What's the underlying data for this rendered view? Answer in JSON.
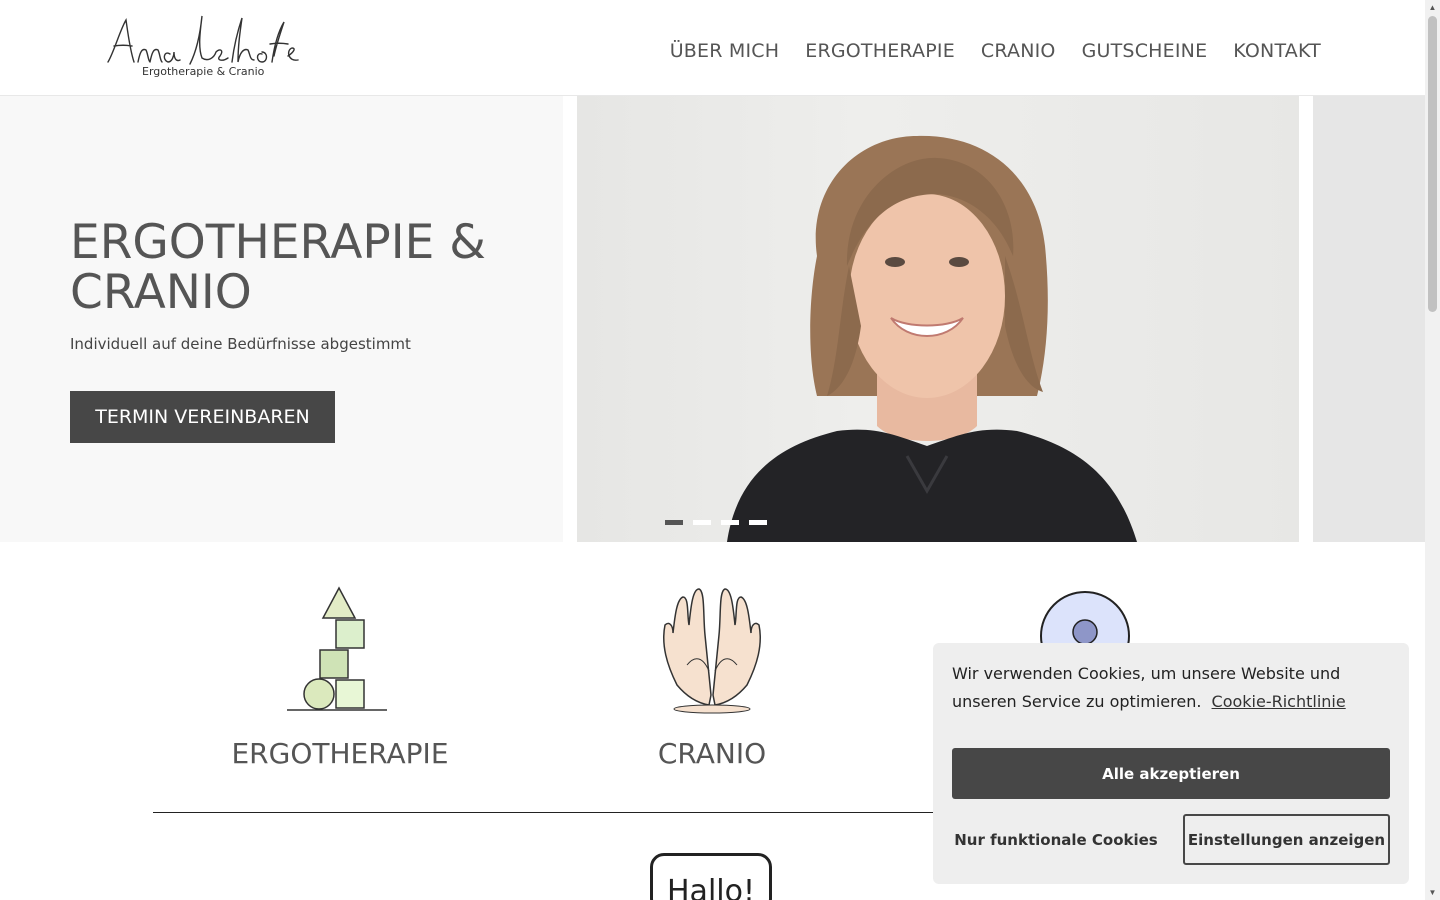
{
  "header": {
    "logo_script": "Anna Lehofer",
    "logo_subtitle": "Ergotherapie & Cranio",
    "nav": [
      {
        "label": "ÜBER MICH"
      },
      {
        "label": "ERGOTHERAPIE"
      },
      {
        "label": "CRANIO"
      },
      {
        "label": "GUTSCHEINE"
      },
      {
        "label": "KONTAKT"
      }
    ]
  },
  "hero": {
    "title": "ERGOTHERAPIE & CRANIO",
    "subtitle": "Individuell auf deine Bedürfnisse abgestimmt",
    "cta_label": "TERMIN VEREINBAREN",
    "slide_count": 4,
    "active_slide": 1
  },
  "services": [
    {
      "label": "ERGOTHERAPIE",
      "icon": "stacked-blocks-icon"
    },
    {
      "label": "CRANIO",
      "icon": "open-hands-icon"
    },
    {
      "label": "",
      "icon": "person-circle-icon"
    }
  ],
  "greeting": {
    "text": "Hallo!"
  },
  "cookie_banner": {
    "message": "Wir verwenden Cookies, um unsere Website und unseren Service zu optimieren.",
    "policy_link": "Cookie-Richtlinie",
    "accept_all": "Alle akzeptieren",
    "functional_only": "Nur funktionale Cookies",
    "show_settings": "Einstellungen anzeigen"
  },
  "colors": {
    "button_dark": "#474747",
    "text": "#555555",
    "hero_bg": "#f8f8f8",
    "banner_bg": "#eeeeee"
  }
}
